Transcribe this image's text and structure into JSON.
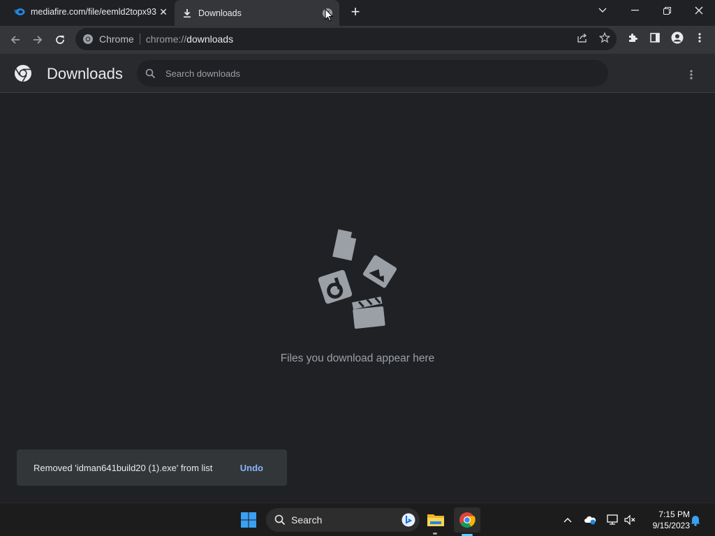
{
  "tabs": [
    {
      "title": "mediafire.com/file/eemld2topx93",
      "icon": "mediafire-icon",
      "active": false
    },
    {
      "title": "Downloads",
      "icon": "download-icon",
      "active": true
    }
  ],
  "omnibox": {
    "site_label": "Chrome",
    "url_scheme": "chrome://",
    "url_host": "downloads"
  },
  "downloads_page": {
    "title": "Downloads",
    "search_placeholder": "Search downloads",
    "empty_message": "Files you download appear here"
  },
  "toast": {
    "message": "Removed 'idman641build20 (1).exe' from list",
    "action": "Undo"
  },
  "taskbar": {
    "search_label": "Search",
    "time": "7:15 PM",
    "date": "9/15/2023"
  },
  "colors": {
    "page_bg": "#202124",
    "toolbar_bg": "#35363a",
    "header_bg": "#292a2d",
    "link_blue": "#8ab4f8",
    "taskbar_bg": "#1c1c1c"
  }
}
